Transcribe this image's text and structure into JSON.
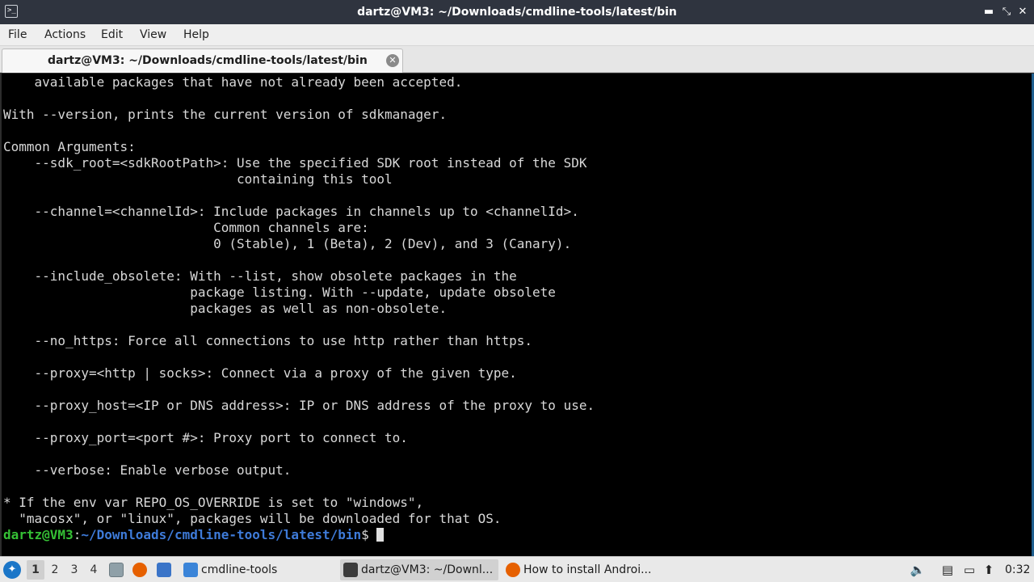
{
  "window": {
    "title": "dartz@VM3: ~/Downloads/cmdline-tools/latest/bin",
    "app_icon": "terminal-icon",
    "controls": [
      "minimize-icon",
      "restore-icon",
      "close-icon"
    ],
    "minimize_glyph": "▬",
    "restore_glyph": "⤡",
    "close_glyph": "✕",
    "app_icon_glyph": ">_"
  },
  "menubar": {
    "items": [
      {
        "label": "File"
      },
      {
        "label": "Actions"
      },
      {
        "label": "Edit"
      },
      {
        "label": "View"
      },
      {
        "label": "Help"
      }
    ]
  },
  "tabs": [
    {
      "label": "dartz@VM3: ~/Downloads/cmdline-tools/latest/bin",
      "close_glyph": "✕"
    }
  ],
  "terminal": {
    "lines": [
      "    available packages that have not already been accepted.",
      "",
      "With --version, prints the current version of sdkmanager.",
      "",
      "Common Arguments:",
      "    --sdk_root=<sdkRootPath>: Use the specified SDK root instead of the SDK",
      "                              containing this tool",
      "",
      "    --channel=<channelId>: Include packages in channels up to <channelId>.",
      "                           Common channels are:",
      "                           0 (Stable), 1 (Beta), 2 (Dev), and 3 (Canary).",
      "",
      "    --include_obsolete: With --list, show obsolete packages in the",
      "                        package listing. With --update, update obsolete",
      "                        packages as well as non-obsolete.",
      "",
      "    --no_https: Force all connections to use http rather than https.",
      "",
      "    --proxy=<http | socks>: Connect via a proxy of the given type.",
      "",
      "    --proxy_host=<IP or DNS address>: IP or DNS address of the proxy to use.",
      "",
      "    --proxy_port=<port #>: Proxy port to connect to.",
      "",
      "    --verbose: Enable verbose output.",
      "",
      "* If the env var REPO_OS_OVERRIDE is set to \"windows\",",
      "  \"macosx\", or \"linux\", packages will be downloaded for that OS."
    ],
    "prompt": {
      "user_host": "dartz@VM3",
      "separator": ":",
      "path": "~/Downloads/cmdline-tools/latest/bin",
      "symbol": "$ "
    }
  },
  "taskbar": {
    "start_glyph": "✦",
    "workspaces": [
      "1",
      "2",
      "3",
      "4"
    ],
    "active_workspace": "1",
    "quicklaunch": [
      "file-manager-icon",
      "firefox-icon",
      "desktop-icon"
    ],
    "tasks": [
      {
        "label": "cmdline-tools",
        "icon": "folder-icon",
        "active": false
      },
      {
        "label": "dartz@VM3: ~/Downl...",
        "icon": "terminal-icon",
        "active": true
      },
      {
        "label": "How to install Androi...",
        "icon": "firefox-icon",
        "active": false
      }
    ],
    "tray": [
      "volume-icon",
      "clipboard-icon",
      "display-icon",
      "updates-icon"
    ],
    "tray_glyphs": [
      "🔈",
      "▤",
      "▭",
      "⬆"
    ],
    "clock": "0:32",
    "colors": {
      "folder": "#3a84d8",
      "firefox": "#e66000",
      "terminal": "#3b3b3b",
      "file_manager": "#8fa0a8",
      "desktop": "#3a74c8"
    }
  }
}
